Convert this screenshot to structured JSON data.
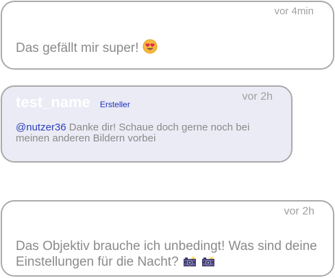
{
  "comments": [
    {
      "time": "vor 4min",
      "text": "Das gefällt mir super!",
      "emoji": "smiling-face-with-heart-eyes"
    },
    {
      "author": "test_name",
      "badge": "Ersteller",
      "time": "vor 2h",
      "mention": "@nutzer36",
      "text": "Danke dir! Schaue doch gerne noch bei meinen anderen Bildern vorbei"
    },
    {
      "time": "vor 2h",
      "text": "Das Objektiv brauche ich unbedingt! Was sind deine Einstellungen für die Nacht?",
      "emojis": [
        "camera-with-flash",
        "camera-with-flash"
      ]
    }
  ],
  "colors": {
    "border": "#a9a9a9",
    "highlight_bg": "#ebebf6",
    "mention": "#2a3fb8",
    "badge": "#1a2dbd",
    "text": "#8a8a8a",
    "time": "#a0a0a0"
  }
}
